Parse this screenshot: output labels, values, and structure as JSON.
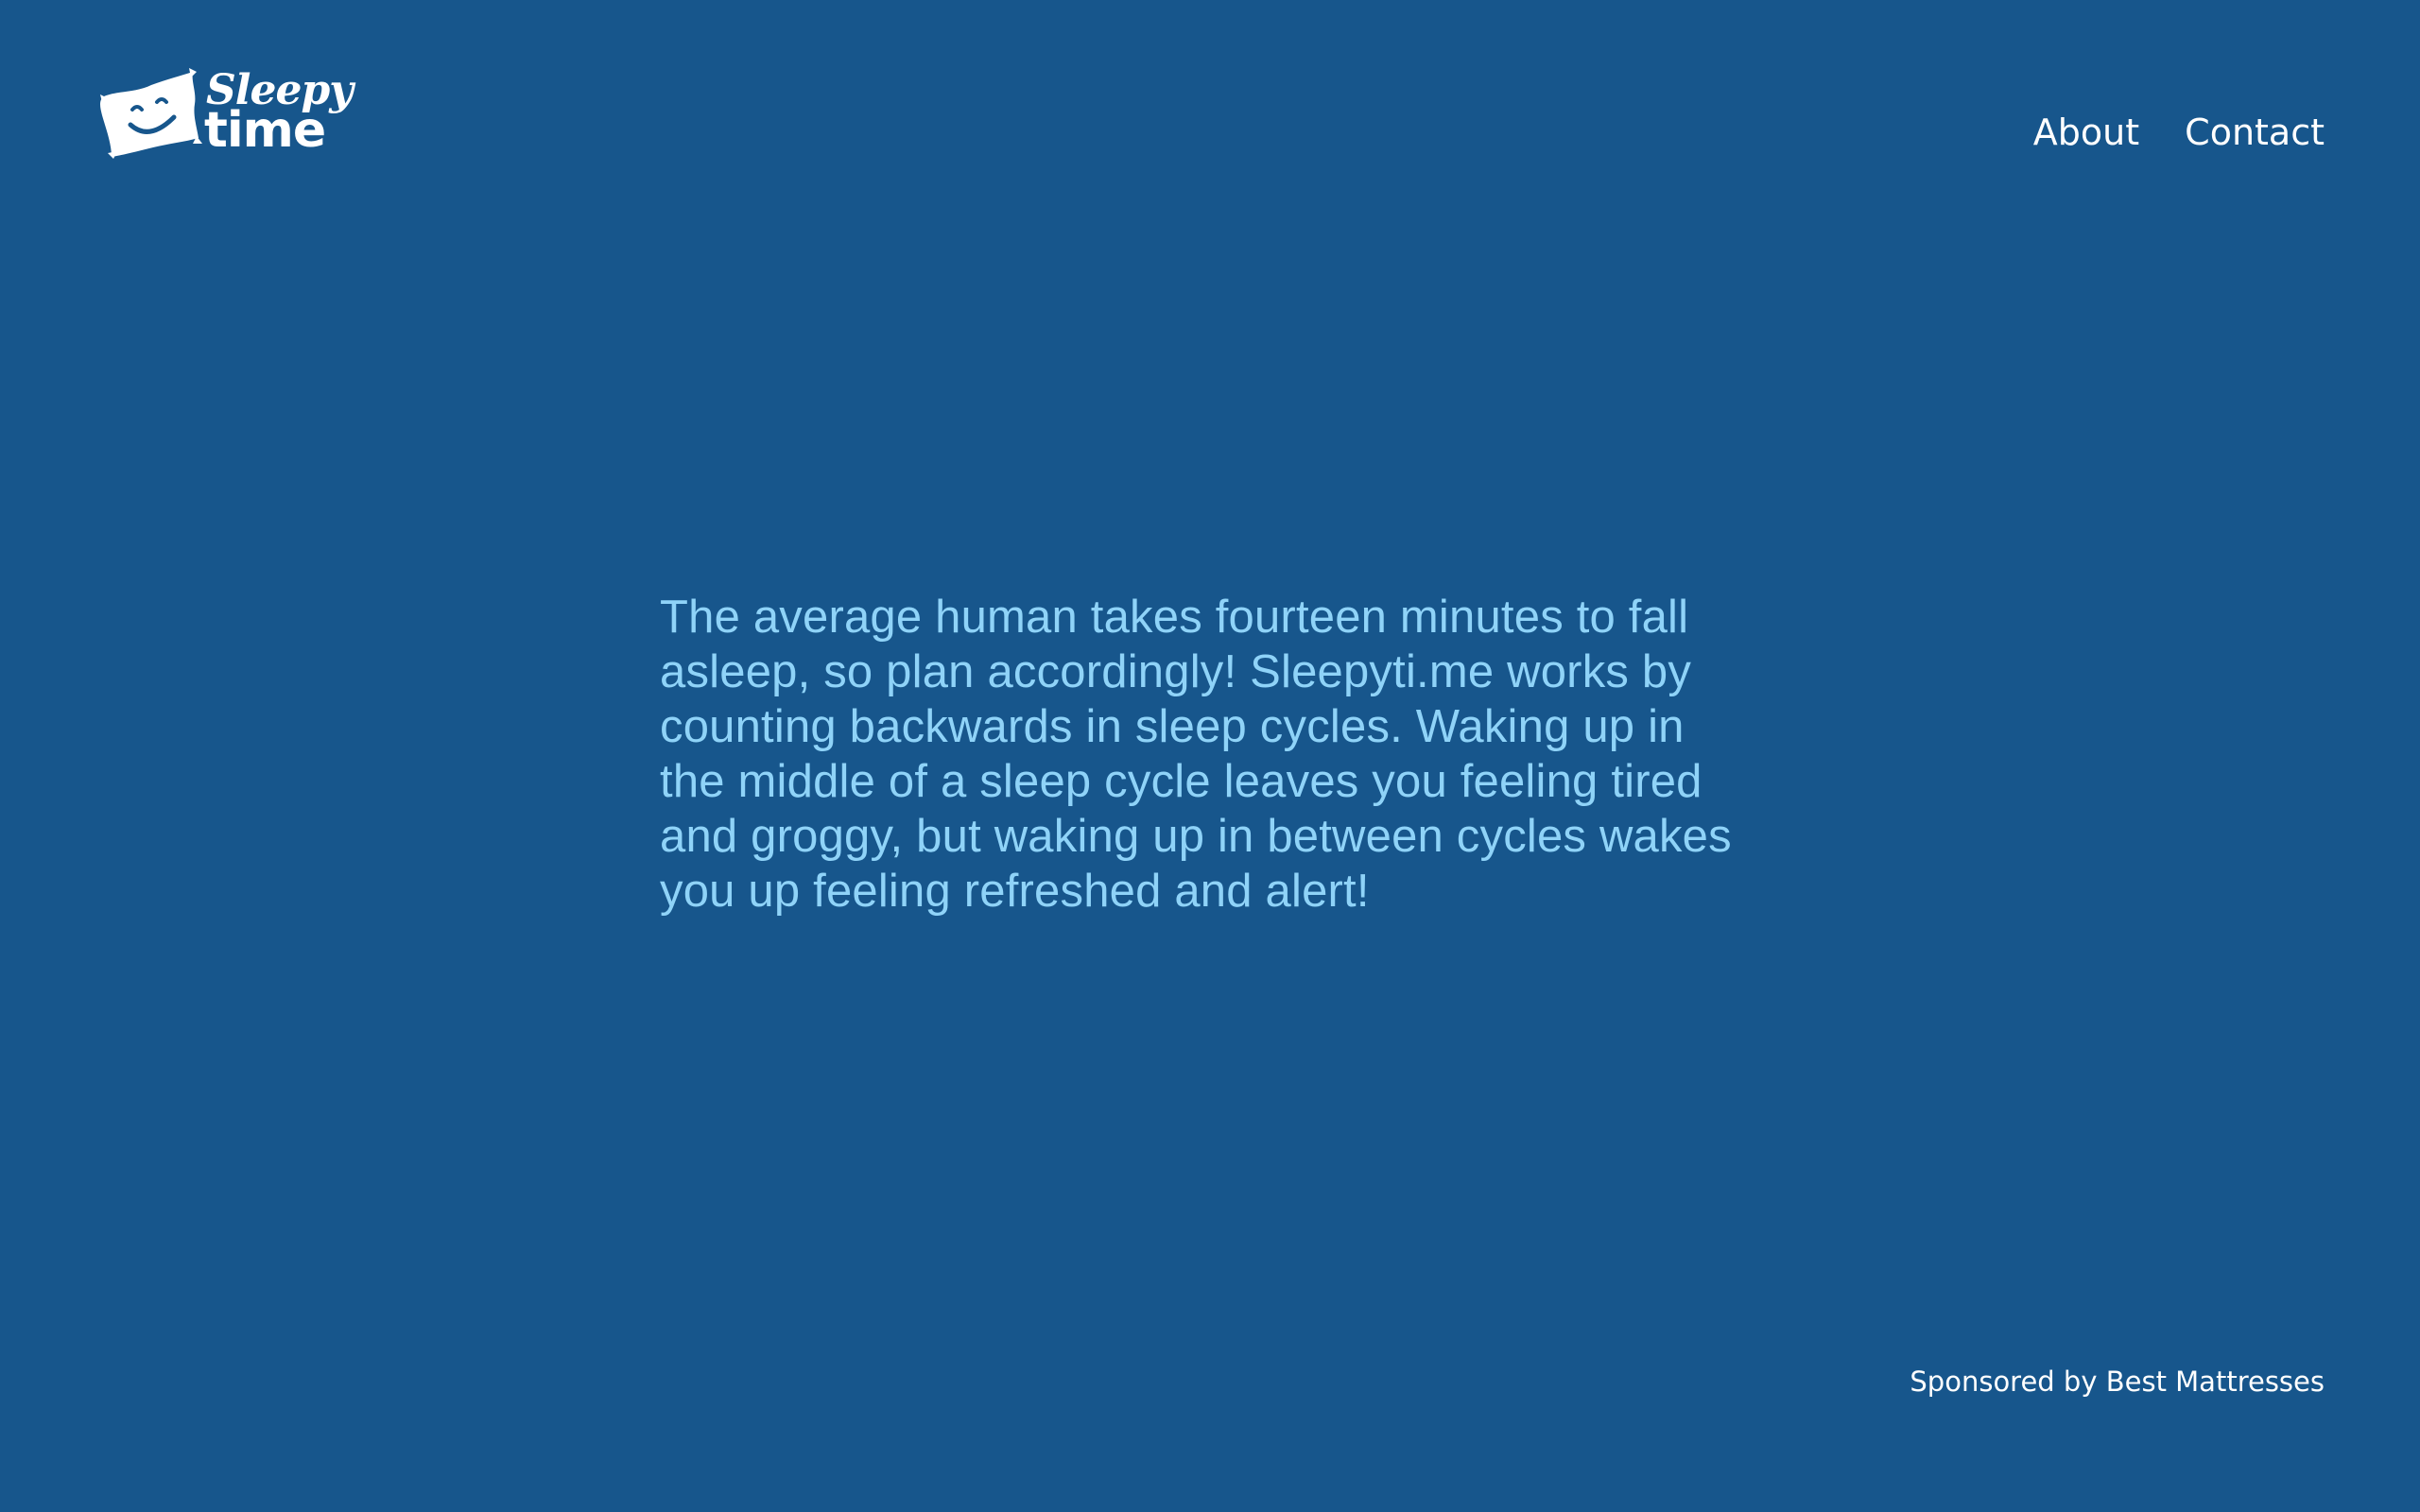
{
  "brand": {
    "line1": "Sleepy",
    "line2": "time",
    "logo_icon": "smiling-pillow-icon"
  },
  "nav": {
    "about": "About",
    "contact": "Contact"
  },
  "intro": {
    "text": "The average human takes fourteen minutes to fall asleep, so plan accordingly! Sleepyti.me works by counting backwards in sleep cycles. Waking up in the middle of a sleep cycle leaves you feeling tired and groggy, but waking up in between cycles wakes you up feeling refreshed and alert!"
  },
  "footer": {
    "sponsor": "Sponsored by Best Mattresses"
  },
  "colors": {
    "background": "#17568c",
    "body_text": "#8fd3f8",
    "nav_text": "#ffffff"
  }
}
